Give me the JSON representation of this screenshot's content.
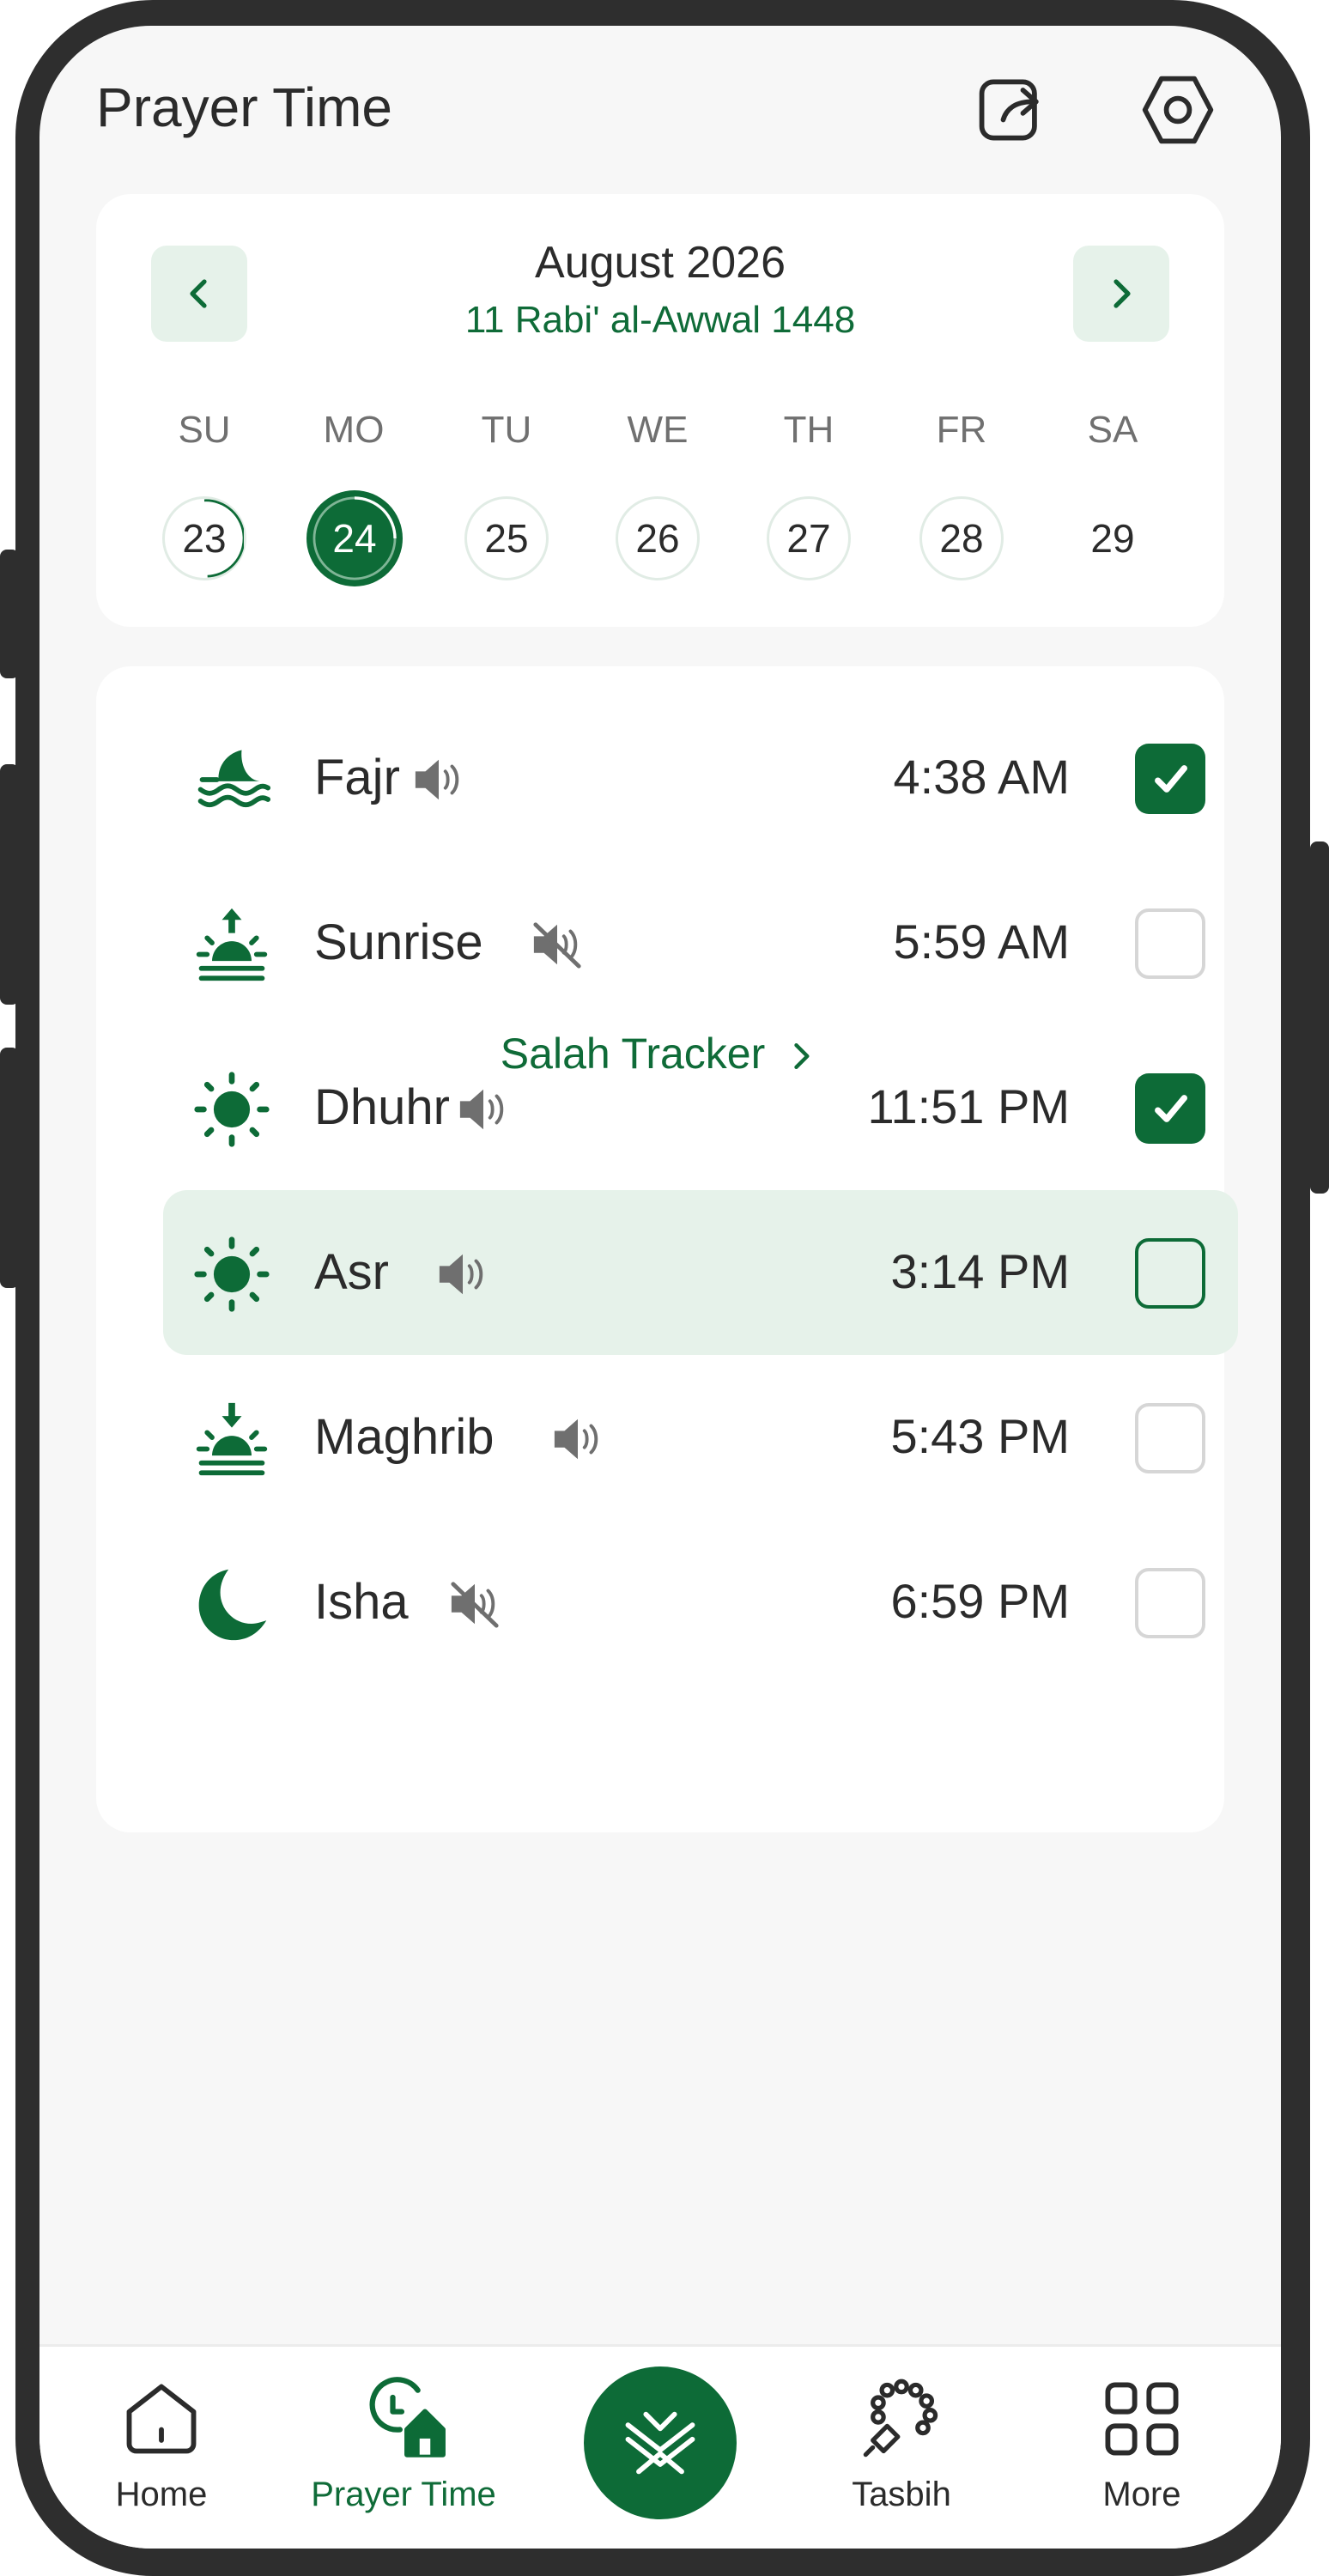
{
  "header": {
    "title": "Prayer Time",
    "share_icon": "share-icon",
    "settings_icon": "settings-hexagon-icon"
  },
  "calendar": {
    "month": "August 2026",
    "hijri": "11 Rabi' al-Awwal 1448",
    "weekdays": [
      "SU",
      "MO",
      "TU",
      "WE",
      "TH",
      "FR",
      "SA"
    ],
    "days": [
      "23",
      "24",
      "25",
      "26",
      "27",
      "28",
      "29"
    ],
    "selected_day": "24"
  },
  "prayers": [
    {
      "name": "Fajr",
      "time": "4:38 AM",
      "sound": "on",
      "done": true
    },
    {
      "name": "Sunrise",
      "time": "5:59 AM",
      "sound": "muted",
      "done": false
    },
    {
      "name": "Dhuhr",
      "time": "11:51 PM",
      "sound": "on",
      "done": true
    },
    {
      "name": "Asr",
      "time": "3:14 PM",
      "sound": "on",
      "done": false,
      "current": true
    },
    {
      "name": "Maghrib",
      "time": "5:43 PM",
      "sound": "on",
      "done": false
    },
    {
      "name": "Isha",
      "time": "6:59 PM",
      "sound": "muted",
      "done": false
    }
  ],
  "tracker_link": "Salah Tracker",
  "bottom_nav": {
    "home": "Home",
    "prayer_time": "Prayer Time",
    "tasbih": "Tasbih",
    "more": "More"
  },
  "colors": {
    "accent": "#0d6b37",
    "accent_light": "#e6f2ea",
    "text": "#2b2b2b"
  }
}
